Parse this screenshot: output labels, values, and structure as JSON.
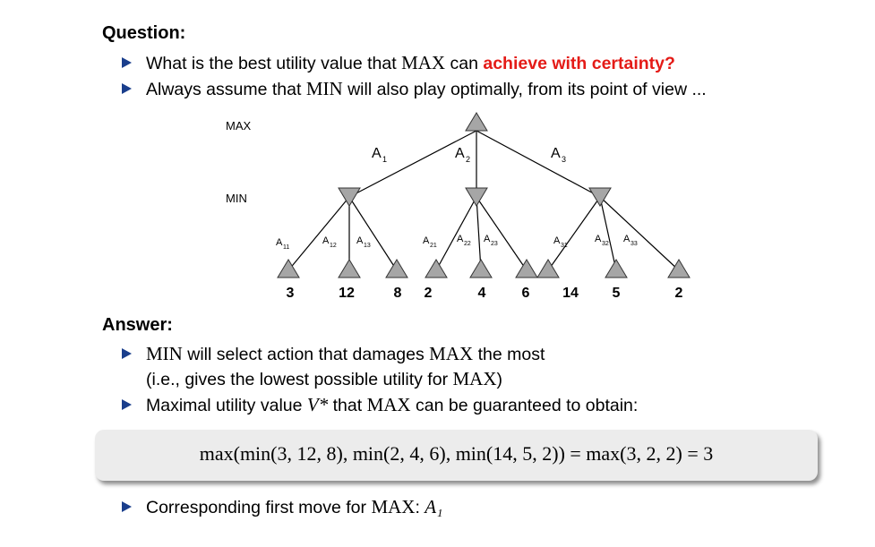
{
  "question": {
    "heading": "Question:",
    "bullet1_pre": "What is the best utility value that ",
    "bullet1_max": "MAX",
    "bullet1_mid": " can ",
    "bullet1_emph": "achieve with certainty?",
    "bullet2_pre": "Always assume that ",
    "bullet2_min": "MIN",
    "bullet2_post": " will also play optimally, from its point of view ..."
  },
  "tree": {
    "max_label": "MAX",
    "min_label": "MIN",
    "top_actions": [
      {
        "main": "A",
        "sub": "1"
      },
      {
        "main": "A",
        "sub": "2"
      },
      {
        "main": "A",
        "sub": "3"
      }
    ],
    "min_actions": [
      {
        "main": "A",
        "sub": "11"
      },
      {
        "main": "A",
        "sub": "12"
      },
      {
        "main": "A",
        "sub": "13"
      },
      {
        "main": "A",
        "sub": "21"
      },
      {
        "main": "A",
        "sub": "22"
      },
      {
        "main": "A",
        "sub": "23"
      },
      {
        "main": "A",
        "sub": "31"
      },
      {
        "main": "A",
        "sub": "32"
      },
      {
        "main": "A",
        "sub": "33"
      }
    ],
    "leaf_values": [
      "3",
      "12",
      "8",
      "2",
      "4",
      "6",
      "14",
      "5",
      "2"
    ],
    "node_color": "#a6a6a6"
  },
  "answer": {
    "heading": "Answer:",
    "bullet1_min": "MIN",
    "bullet1_post": " will select action that damages ",
    "bullet1_max": "MAX",
    "bullet1_end": " the most",
    "bullet1_cont_pre": "(i.e., gives the lowest possible utility for ",
    "bullet1_cont_max": "MAX",
    "bullet1_cont_end": ")",
    "bullet2_pre": "Maximal utility value ",
    "bullet2_var": "V*",
    "bullet2_mid": " that ",
    "bullet2_max": "MAX",
    "bullet2_post": " can be guaranteed to obtain:",
    "formula": "max(min(3, 12, 8), min(2, 4, 6), min(14, 5, 2)) = max(3, 2, 2) = 3",
    "bullet3_pre": "Corresponding first move for ",
    "bullet3_max": "MAX",
    "bullet3_colon": ": ",
    "bullet3_var": "A₁"
  },
  "colors": {
    "bullet": "#1a3e8c",
    "emphasis": "#e41b17",
    "box": "#ececec"
  }
}
